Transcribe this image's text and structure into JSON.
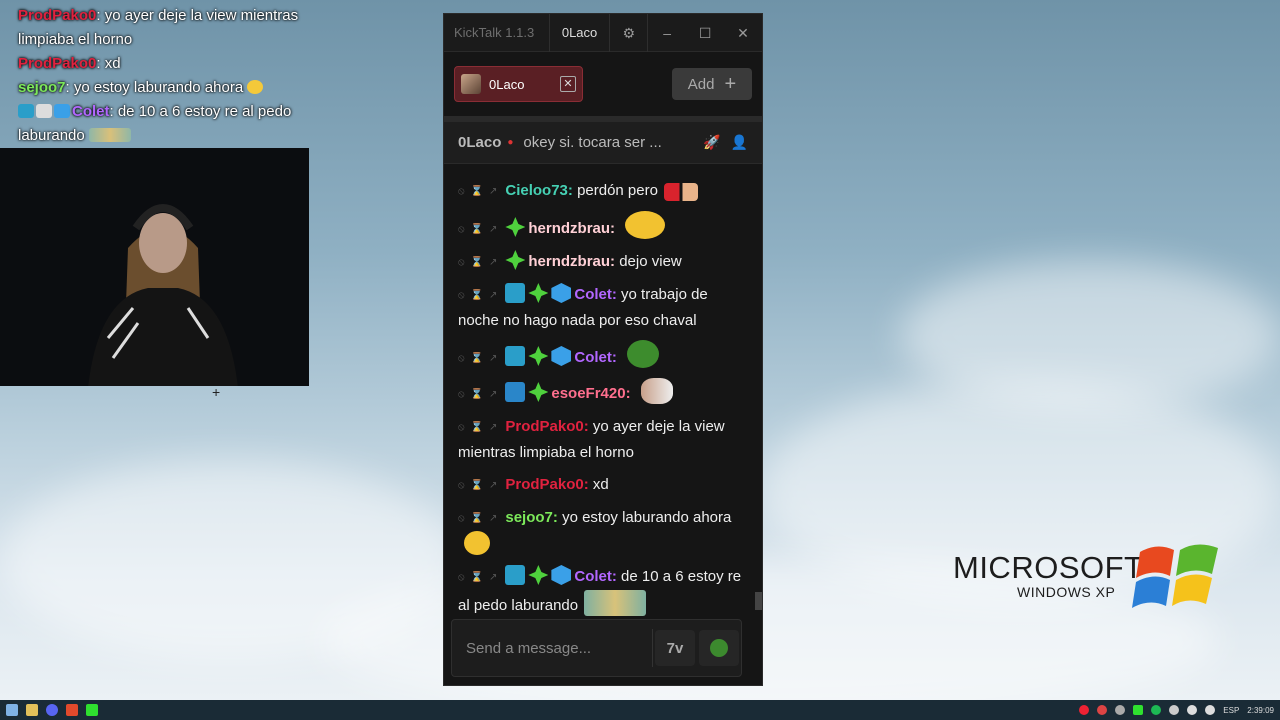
{
  "overlay_chat": [
    {
      "user": "ProdPako0",
      "color": "#e0223f",
      "text": "yo ayer deje la view mientras limpiaba el horno"
    },
    {
      "user": "ProdPako0",
      "color": "#e0223f",
      "text": "xd"
    },
    {
      "user": "sejoo7",
      "color": "#7ce85a",
      "text": "yo estoy laburando ahora"
    },
    {
      "user": "Colet",
      "color": "#b267ff",
      "text": "de 10 a 6 estoy re al pedo laburando"
    }
  ],
  "window": {
    "app_title": "KickTalk 1.1.3",
    "user_tab": "0Laco",
    "minimize": "–",
    "maximize": "☐",
    "close": "✕"
  },
  "tabs": {
    "active_channel": "0Laco",
    "close_label": "✕",
    "add_label": "Add",
    "add_icon": "+"
  },
  "pinned": {
    "channel": "0Laco",
    "message": "okey si. tocara ser ..."
  },
  "messages": [
    {
      "user": "Cieloo73",
      "color": "#46d1b4",
      "text": "perdón pero",
      "badges": [],
      "emote": "heart-bandage"
    },
    {
      "user": "herndzbrau",
      "color": "#ffd0d6",
      "text": "",
      "badges": [
        "sub"
      ],
      "emote": "wave"
    },
    {
      "user": "herndzbrau",
      "color": "#ffd0d6",
      "text": "dejo view",
      "badges": [
        "sub"
      ],
      "emote": ""
    },
    {
      "user": "Colet",
      "color": "#b267ff",
      "text": "yo trabajo de noche no hago nada por eso chaval",
      "badges": [
        "og",
        "sub",
        "cube"
      ],
      "emote": ""
    },
    {
      "user": "Colet",
      "color": "#b267ff",
      "text": "",
      "badges": [
        "og",
        "sub",
        "cube"
      ],
      "emote": "pepe"
    },
    {
      "user": "esoeFr420",
      "color": "#ff6f8e",
      "text": "",
      "badges": [
        "mod",
        "sub"
      ],
      "emote": "point"
    },
    {
      "user": "ProdPako0",
      "color": "#e0223f",
      "text": "yo ayer deje la view mientras limpiaba el horno",
      "badges": [],
      "emote": ""
    },
    {
      "user": "ProdPako0",
      "color": "#e0223f",
      "text": "xd",
      "badges": [],
      "emote": ""
    },
    {
      "user": "sejoo7",
      "color": "#7ce85a",
      "text": "yo estoy laburando ahora",
      "badges": [],
      "emote": "hardhat"
    },
    {
      "user": "Colet",
      "color": "#b267ff",
      "text": "de 10 a 6 estoy re al pedo laburando",
      "badges": [
        "og",
        "sub",
        "cube"
      ],
      "emote": "wide"
    }
  ],
  "input": {
    "placeholder": "Send a message..."
  },
  "desktop": {
    "logo_main": "MICROSOFT",
    "logo_sub": "WINDOWS XP"
  },
  "taskbar": {
    "lang": "ESP",
    "time": "2:39:09"
  }
}
